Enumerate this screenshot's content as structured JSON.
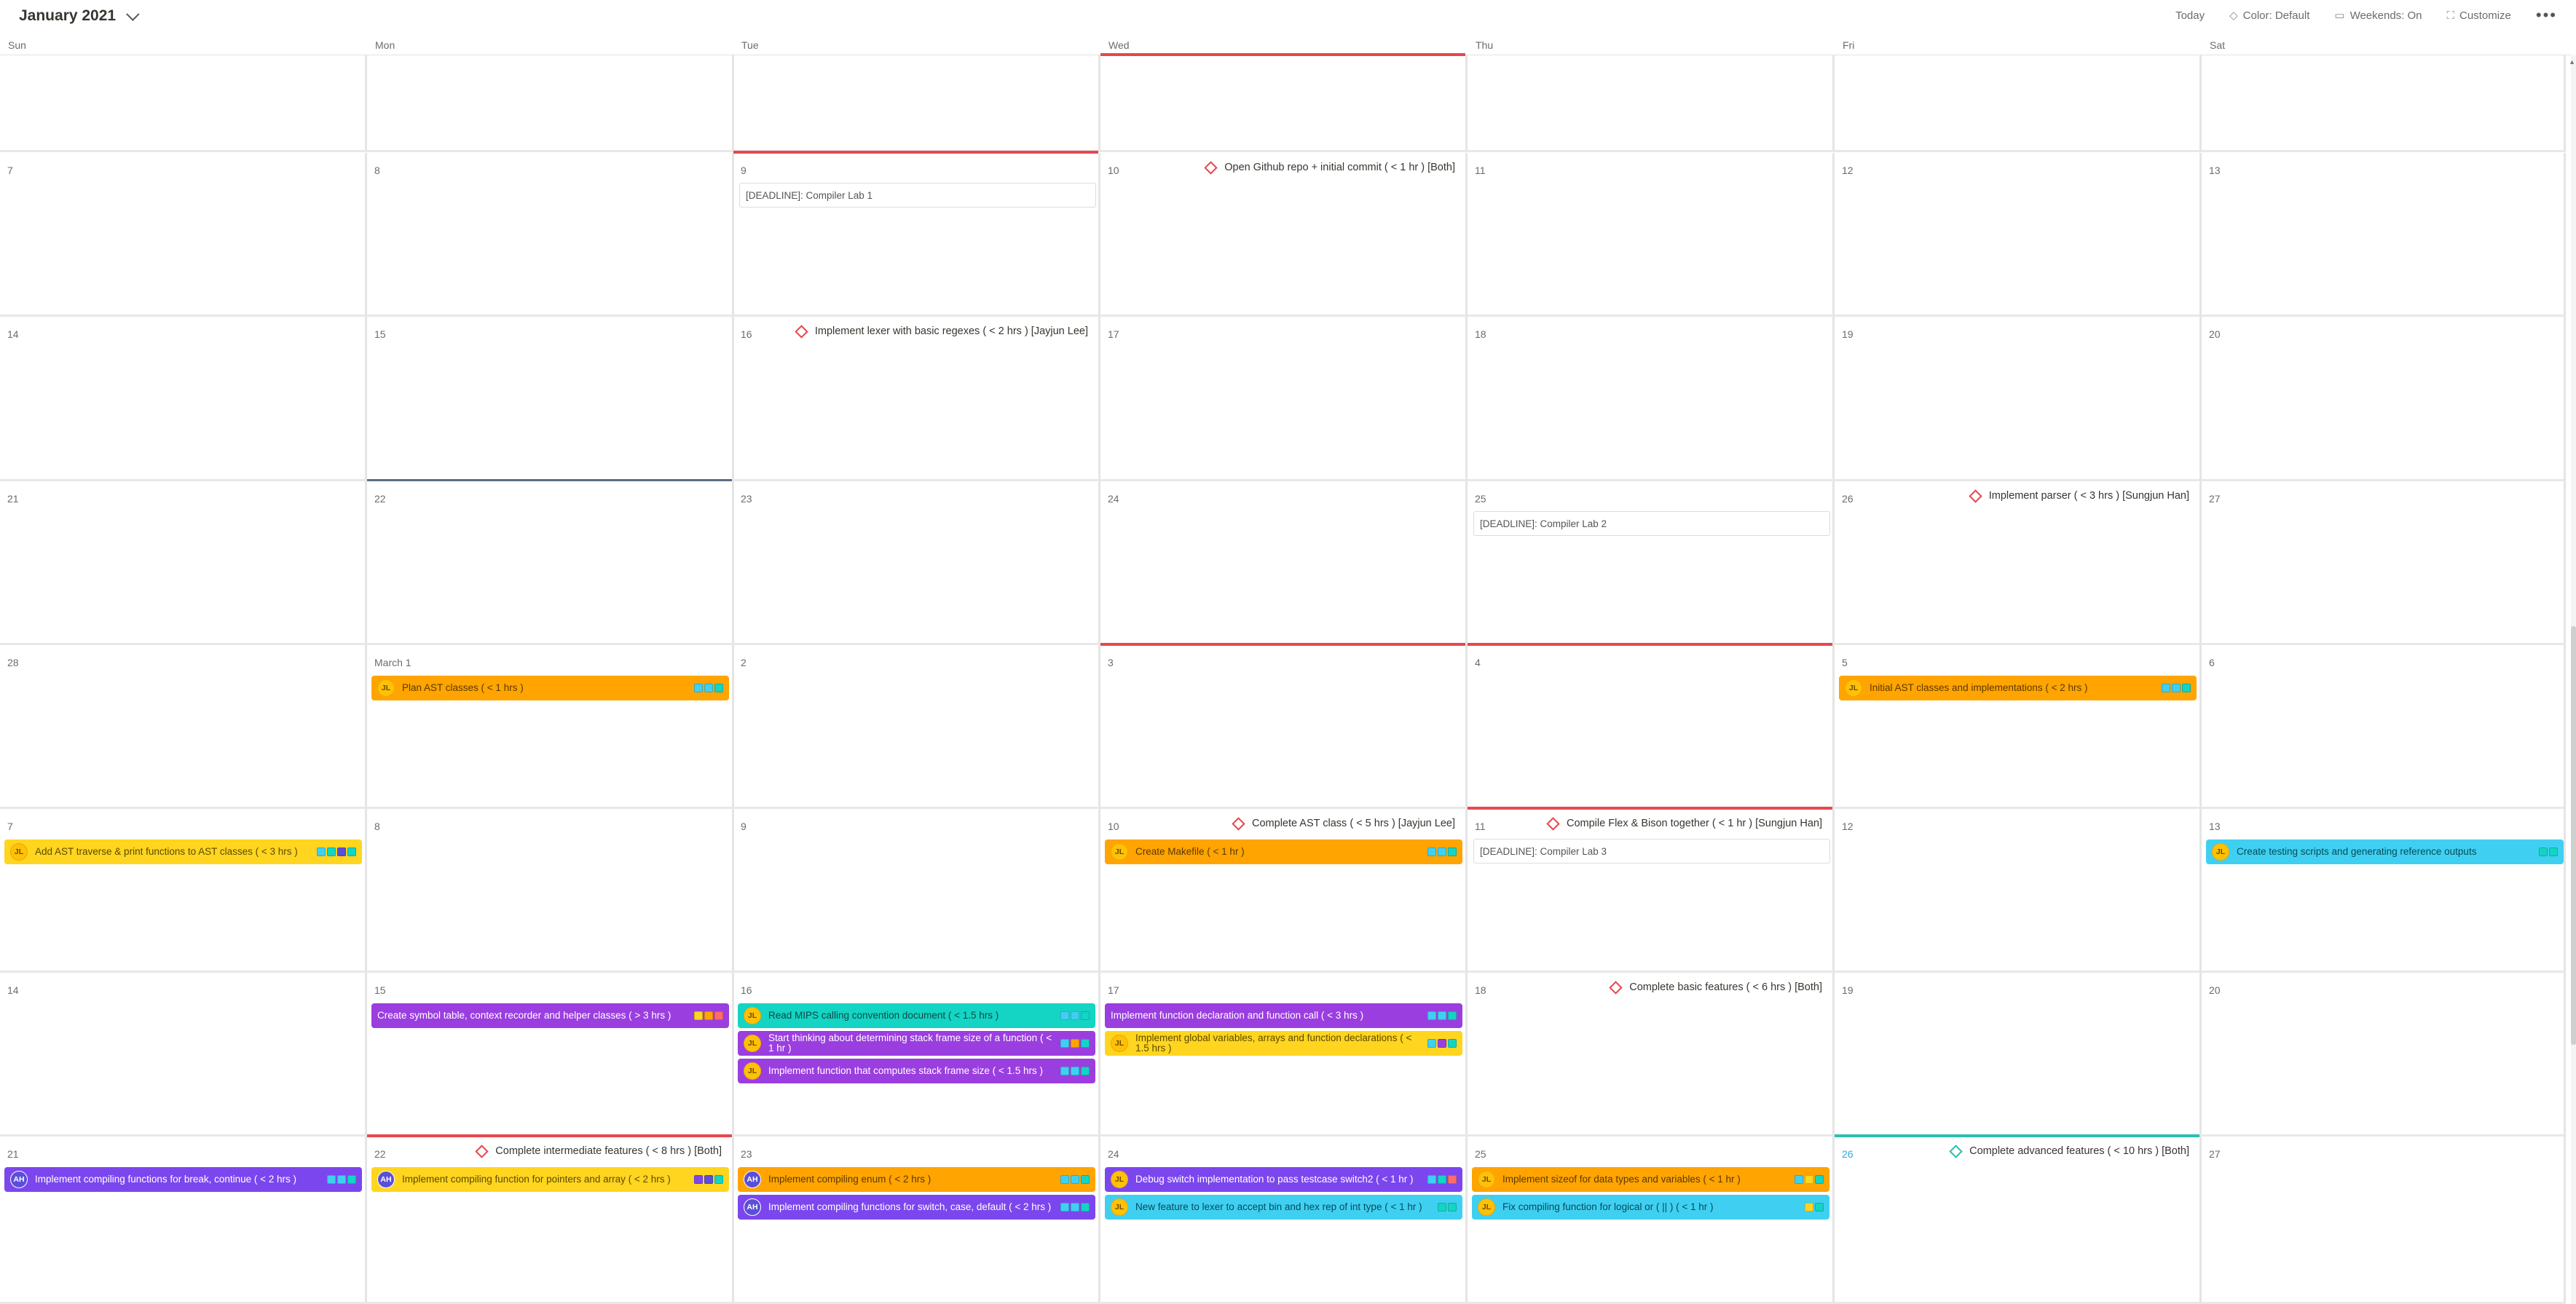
{
  "header": {
    "month_title": "January 2021",
    "today": "Today",
    "color": "Color: Default",
    "weekends": "Weekends: On",
    "customize": "Customize",
    "more": "•••"
  },
  "weekdays": [
    "Sun",
    "Mon",
    "Tue",
    "Wed",
    "Thu",
    "Fri",
    "Sat"
  ],
  "colors": {
    "milestone_red": "#e5484d",
    "milestone_teal": "#2bbfb0",
    "today_blue": "#2ea7e0",
    "month_start_line": "#5b6f80",
    "orange": "#ffa400",
    "yellow": "#ffd51f",
    "purple": "#9b3ee0",
    "teal": "#14d4c4",
    "cyan": "#3fd0f1",
    "violet": "#7c46ee"
  },
  "weeks": [
    {
      "days": [
        "",
        "",
        "",
        "",
        "",
        "",
        ""
      ],
      "milestones": [],
      "deadlines": [],
      "tasks": [],
      "today": -1,
      "marker_lines": [
        {
          "col": 3,
          "color": "red"
        }
      ]
    },
    {
      "days": [
        "7",
        "8",
        "9",
        "10",
        "11",
        "12",
        "13"
      ],
      "milestones": [
        {
          "col": 3,
          "title": "Open Github repo + initial commit ( < 1 hr ) [Both]",
          "color": "red"
        }
      ],
      "deadlines": [
        {
          "col": 2,
          "title": "[DEADLINE]: Compiler Lab 1"
        }
      ],
      "tasks": [],
      "marker_lines": [
        {
          "col": 2,
          "color": "red"
        }
      ]
    },
    {
      "days": [
        "14",
        "15",
        "16",
        "17",
        "18",
        "19",
        "20"
      ],
      "milestones": [
        {
          "col": 2,
          "title": "Implement lexer with basic regexes ( < 2 hrs ) [Jayjun Lee]",
          "color": "red"
        }
      ],
      "deadlines": [],
      "tasks": [],
      "marker_lines": []
    },
    {
      "days": [
        "21",
        "22",
        "23",
        "24",
        "25",
        "26",
        "27"
      ],
      "milestones": [
        {
          "col": 5,
          "title": "Implement parser ( < 3 hrs ) [Sungjun Han]",
          "color": "red"
        }
      ],
      "deadlines": [
        {
          "col": 4,
          "title": "[DEADLINE]: Compiler Lab 2"
        }
      ],
      "tasks": [],
      "marker_lines": [
        {
          "col": 1,
          "color": "dark"
        }
      ]
    },
    {
      "days": [
        "28",
        "March 1",
        "2",
        "3",
        "4",
        "5",
        "6"
      ],
      "milestones": [],
      "deadlines": [],
      "tasks": [
        {
          "col": 1,
          "slot": 0,
          "title": "Plan AST classes ( < 1 hrs )",
          "avatar": "JL",
          "color": "orange",
          "tags": [
            "#3fd0f1",
            "#3fd0f1",
            "#14d4c4"
          ]
        },
        {
          "col": 5,
          "slot": 0,
          "title": "Initial AST classes and implementations ( < 2 hrs )",
          "avatar": "JL",
          "color": "orange",
          "tags": [
            "#3fd0f1",
            "#3fd0f1",
            "#14d4c4"
          ]
        }
      ],
      "marker_lines": [
        {
          "col": 3,
          "color": "red"
        },
        {
          "col": 4,
          "color": "red"
        }
      ]
    },
    {
      "days": [
        "7",
        "8",
        "9",
        "10",
        "11",
        "12",
        "13"
      ],
      "milestones": [
        {
          "col": 3,
          "title": "Complete AST class ( < 5 hrs ) [Jayjun Lee]",
          "color": "red"
        },
        {
          "col": 4,
          "title": "Compile Flex & Bison together ( < 1 hr ) [Sungjun Han]",
          "color": "red"
        }
      ],
      "deadlines": [
        {
          "col": 4,
          "title": "[DEADLINE]: Compiler Lab 3"
        }
      ],
      "tasks": [
        {
          "col": 0,
          "slot": 0,
          "title": "Add AST traverse & print functions to AST classes ( < 3 hrs )",
          "avatar": "JL",
          "color": "yellow",
          "tags": [
            "#3fd0f1",
            "#14d4c4",
            "#5b4fd8",
            "#14d4c4"
          ]
        },
        {
          "col": 3,
          "slot": 0,
          "title": "Create Makefile ( < 1 hr )",
          "avatar": "JL",
          "color": "orange",
          "tags": [
            "#3fd0f1",
            "#3fd0f1",
            "#14d4c4"
          ]
        },
        {
          "col": 6,
          "slot": 0,
          "title": "Create testing scripts and generating reference outputs",
          "avatar": "JL",
          "color": "cyan",
          "tags": [
            "#14d4c4",
            "#14d4c4"
          ]
        }
      ],
      "marker_lines": [
        {
          "col": 4,
          "color": "red"
        }
      ]
    },
    {
      "days": [
        "14",
        "15",
        "16",
        "17",
        "18",
        "19",
        "20"
      ],
      "milestones": [
        {
          "col": 4,
          "title": "Complete basic features ( < 6 hrs ) [Both]",
          "color": "red"
        }
      ],
      "deadlines": [],
      "tasks": [
        {
          "col": 1,
          "slot": 0,
          "title": "Create symbol table, context recorder and helper classes ( > 3 hrs )",
          "avatar": "",
          "color": "purple",
          "tags": [
            "#ffd51f",
            "#ffa400",
            "#ff6b6b"
          ]
        },
        {
          "col": 2,
          "slot": 0,
          "title": "Read MIPS calling convention document ( < 1.5 hrs )",
          "avatar": "JL",
          "color": "teal",
          "tags": [
            "#3fd0f1",
            "#3fd0f1",
            "#14d4c4"
          ]
        },
        {
          "col": 2,
          "slot": 1,
          "title": "Start thinking about determining stack frame size of a function ( < 1 hr )",
          "avatar": "JL",
          "color": "purple",
          "tags": [
            "#3fd0f1",
            "#ffa400",
            "#14d4c4"
          ]
        },
        {
          "col": 2,
          "slot": 2,
          "title": "Implement function that computes stack frame size ( < 1.5 hrs )",
          "avatar": "JL",
          "color": "purple",
          "tags": [
            "#3fd0f1",
            "#3fd0f1",
            "#14d4c4"
          ]
        },
        {
          "col": 3,
          "slot": 0,
          "title": "Implement function declaration and function call ( < 3 hrs )",
          "avatar": "",
          "color": "purple",
          "tags": [
            "#3fd0f1",
            "#3fd0f1",
            "#14d4c4"
          ]
        },
        {
          "col": 3,
          "slot": 1,
          "title": "Implement global variables, arrays and function declarations ( < 1.5 hrs )",
          "avatar": "JL",
          "color": "yellow",
          "tags": [
            "#3fd0f1",
            "#9b3ee0",
            "#14d4c4"
          ]
        }
      ],
      "marker_lines": []
    },
    {
      "days": [
        "21",
        "22",
        "23",
        "24",
        "25",
        "26",
        "27"
      ],
      "milestones": [
        {
          "col": 1,
          "title": "Complete intermediate features ( < 8 hrs ) [Both]",
          "color": "red"
        },
        {
          "col": 5,
          "title": "Complete advanced features ( < 10 hrs ) [Both]",
          "color": "teal"
        }
      ],
      "deadlines": [],
      "tasks": [
        {
          "col": 0,
          "slot": 0,
          "title": "Implement compiling functions for break, continue ( < 2 hrs )",
          "avatar": "AH",
          "color": "violet",
          "tags": [
            "#3fd0f1",
            "#3fd0f1",
            "#14d4c4"
          ]
        },
        {
          "col": 1,
          "slot": 0,
          "title": "Implement compiling function for pointers and array ( < 2 hrs )",
          "avatar": "AH",
          "color": "yellow",
          "tags": [
            "#7c46ee",
            "#5b4fd8",
            "#14d4c4"
          ]
        },
        {
          "col": 2,
          "slot": 0,
          "title": "Implement compiling enum ( < 2 hrs )",
          "avatar": "AH",
          "color": "orange",
          "tags": [
            "#3fd0f1",
            "#3fd0f1",
            "#14d4c4"
          ]
        },
        {
          "col": 2,
          "slot": 1,
          "title": "Implement compiling functions for switch, case, default ( < 2 hrs )",
          "avatar": "AH",
          "color": "violet",
          "tags": [
            "#3fd0f1",
            "#3fd0f1",
            "#14d4c4"
          ]
        },
        {
          "col": 3,
          "slot": 0,
          "title": "Debug switch implementation to pass testcase switch2 ( < 1 hr )",
          "avatar": "JL",
          "color": "violet",
          "tags": [
            "#3fd0f1",
            "#14d4c4",
            "#ff6b6b"
          ]
        },
        {
          "col": 3,
          "slot": 1,
          "title": "New feature to lexer to accept bin and hex rep of int type ( < 1 hr )",
          "avatar": "JL",
          "color": "cyan",
          "tags": [
            "#14d4c4",
            "#14d4c4"
          ]
        },
        {
          "col": 4,
          "slot": 0,
          "title": "Implement sizeof for data types and variables ( < 1 hr )",
          "avatar": "JL",
          "color": "orange",
          "tags": [
            "#3fd0f1",
            "#ffd51f",
            "#14d4c4"
          ]
        },
        {
          "col": 4,
          "slot": 1,
          "title": "Fix compiling function for logical or ( || ) ( < 1 hr )",
          "avatar": "JL",
          "color": "cyan",
          "tags": [
            "#ffd51f",
            "#14d4c4"
          ]
        }
      ],
      "today": 5,
      "marker_lines": [
        {
          "col": 1,
          "color": "red"
        },
        {
          "col": 5,
          "color": "teal"
        }
      ]
    }
  ]
}
